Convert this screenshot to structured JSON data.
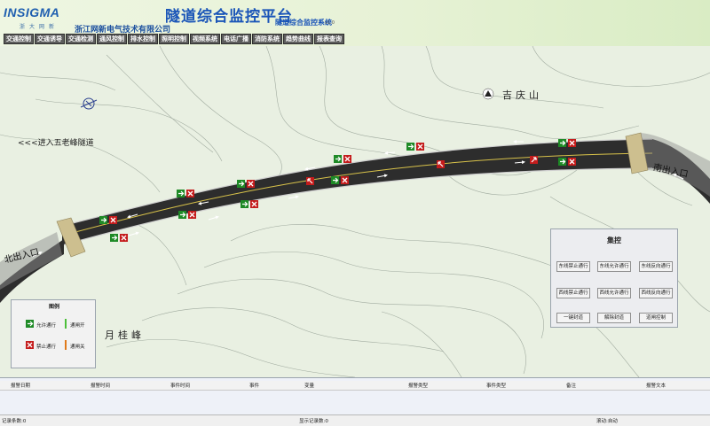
{
  "header": {
    "logo_text": "INSIGMA",
    "logo_sub": "浙大网新",
    "company": "浙江网新电气技术有限公司",
    "title": "隧道综合监控平台",
    "subtitle": "隧道综合监控系统",
    "version": "v1.0"
  },
  "menu": [
    "交通控制",
    "交通诱导",
    "交通检测",
    "通风控制",
    "排水控制",
    "照明控制",
    "视频系统",
    "电话广播",
    "消防系统",
    "趋势曲线",
    "报表查询"
  ],
  "map": {
    "mountain_north": "吉庆山",
    "mountain_south": "月桂峰",
    "tunnel_direction": "<<<进入五老峰隧道",
    "portal_east": "南出入口",
    "portal_west": "北出入口"
  },
  "legend": {
    "title": "图例",
    "items": [
      "允许通行",
      "禁止通行",
      "通闸开",
      "通闸关"
    ]
  },
  "control_panel": {
    "title": "集控",
    "buttons": [
      "东线禁止通行",
      "东线允许通行",
      "东线反向通行",
      "西线禁止通行",
      "西线允许通行",
      "西线反向通行",
      "一键封道",
      "解除封道",
      "道闸控制"
    ]
  },
  "alarm_table": {
    "columns": [
      "报警日期",
      "报警时间",
      "事件时间",
      "事件",
      "变量",
      "报警类型",
      "事件类型",
      "备注",
      "报警文本"
    ]
  },
  "status_bar": {
    "record_count": "记录条数:0",
    "display_count": "显示记录数:0",
    "scroll_state": "滚动:自动"
  },
  "colors": {
    "title_blue": "#1a55b8",
    "signal_green": "#1e8a26",
    "signal_red": "#c41c1c",
    "road_line": "#d8c24a"
  }
}
